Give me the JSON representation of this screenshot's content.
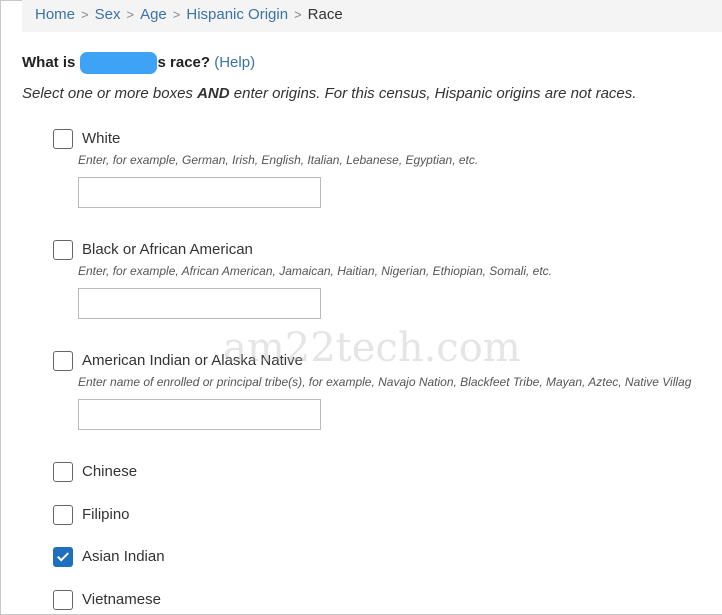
{
  "breadcrumb": {
    "items": [
      "Home",
      "Sex",
      "Age",
      "Hispanic Origin"
    ],
    "current": "Race",
    "separator": ">"
  },
  "question": {
    "prefix": "What is",
    "suffix": "s race?",
    "help": "(Help)",
    "redaction_color": "#3ea3f5"
  },
  "instructions": {
    "before": "Select one or more boxes ",
    "bold": "AND",
    "after": " enter origins. For this census, Hispanic origins are not races."
  },
  "options": [
    {
      "label": "White",
      "checked": false,
      "hint": "Enter, for example, German, Irish, English, Italian, Lebanese, Egyptian, etc.",
      "input_value": ""
    },
    {
      "label": "Black or African American",
      "checked": false,
      "hint": "Enter, for example, African American, Jamaican, Haitian, Nigerian, Ethiopian, Somali, etc.",
      "input_value": ""
    },
    {
      "label": "American Indian or Alaska Native",
      "checked": false,
      "hint": "Enter name of enrolled or principal tribe(s), for example, Navajo Nation, Blackfeet Tribe, Mayan, Aztec, Native Villag",
      "input_value": ""
    },
    {
      "label": "Chinese",
      "checked": false
    },
    {
      "label": "Filipino",
      "checked": false
    },
    {
      "label": "Asian Indian",
      "checked": true
    },
    {
      "label": "Vietnamese",
      "checked": false
    }
  ],
  "watermark": "am22tech.com",
  "colors": {
    "link": "#3b73a5",
    "checkbox_checked": "#1f6fbf"
  }
}
